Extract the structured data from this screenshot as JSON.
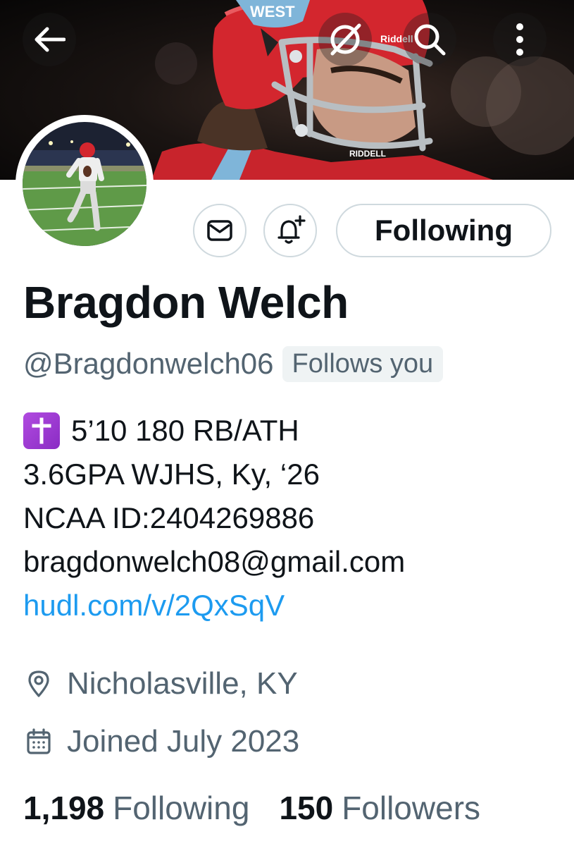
{
  "header": {
    "back_icon": "arrow-left-icon",
    "grok_icon": "grok-icon",
    "search_icon": "search-icon",
    "more_icon": "more-vertical-icon"
  },
  "profile": {
    "display_name": "Bragdon Welch",
    "handle": "@Bragdonwelch06",
    "follows_you": "Follows you",
    "follow_button": "Following",
    "bio": {
      "line1": "5’10 180 RB/ATH",
      "line2": "3.6GPA WJHS, Ky, ‘26",
      "line3": "NCAA ID:2404269886",
      "line4": "bragdonwelch08@gmail.com",
      "link": "hudl.com/v/2QxSqV"
    },
    "location": "Nicholasville, KY",
    "joined": "Joined July 2023",
    "following_count": "1,198",
    "following_label": "Following",
    "followers_count": "150",
    "followers_label": "Followers"
  },
  "colors": {
    "text_primary": "#0f1419",
    "text_secondary": "#536471",
    "link": "#1d9bf0",
    "border": "#cfd9de",
    "emoji_purple": "#9b3bd6"
  }
}
